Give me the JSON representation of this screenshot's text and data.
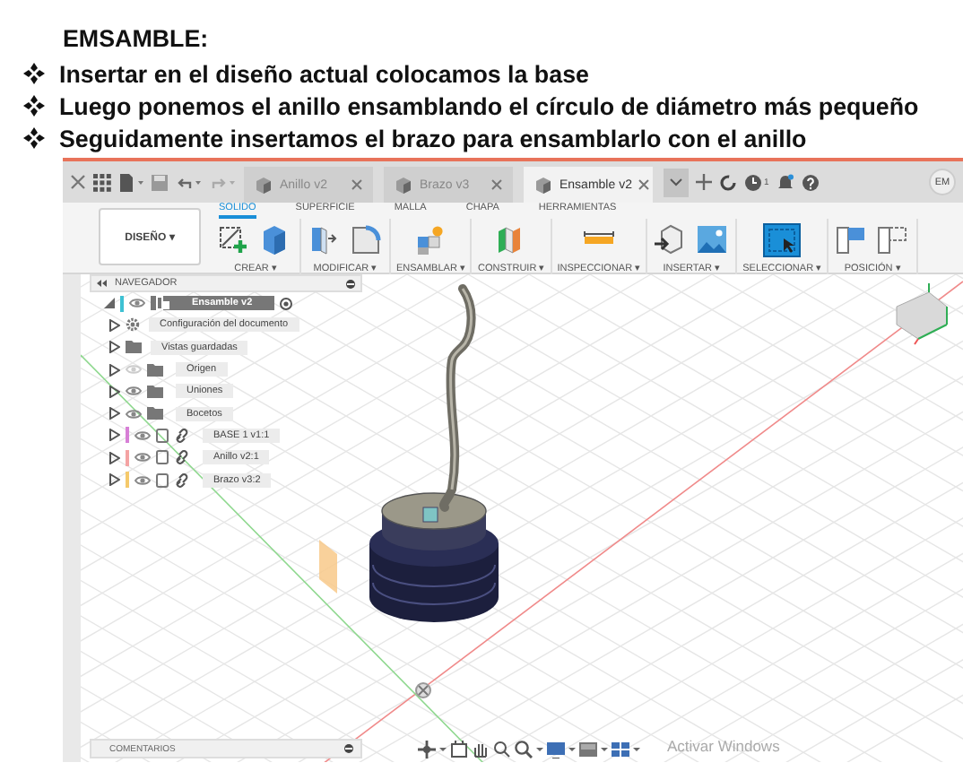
{
  "document": {
    "heading": "EMSAMBLE:",
    "bullets": [
      "Insertar en el diseño actual colocamos la base",
      "Luego ponemos el anillo ensamblando el círculo de diámetro más pequeño",
      "Seguidamente insertamos el brazo para ensamblarlo con el anillo"
    ]
  },
  "app": {
    "topbar": {
      "tabs": [
        {
          "label": "Anillo v2",
          "selected": false
        },
        {
          "label": "Brazo v3",
          "selected": false
        },
        {
          "label": "Ensamble v2",
          "selected": true
        }
      ],
      "job_count": "1",
      "avatar": "EM"
    },
    "ribbon": {
      "workspace": "DISEÑO ▾",
      "tabs": [
        {
          "label": "SOLIDO",
          "selected": true
        },
        {
          "label": "SUPERFICIE",
          "selected": false
        },
        {
          "label": "MALLA",
          "selected": false
        },
        {
          "label": "CHAPA",
          "selected": false
        },
        {
          "label": "HERRAMIENTAS",
          "selected": false
        }
      ],
      "groups": [
        "CREAR ▾",
        "MODIFICAR ▾",
        "ENSAMBLAR ▾",
        "CONSTRUIR ▾",
        "INSPECCIONAR ▾",
        "INSERTAR ▾",
        "SELECCIONAR ▾",
        "POSICIÓN ▾"
      ]
    },
    "navigator": {
      "title": "NAVEGADOR",
      "root": {
        "label": "Ensamble v2",
        "expanded": true,
        "selected": true,
        "children": [
          {
            "kind": "settings",
            "label": "Configuración del documento",
            "expanded": false,
            "selected": false
          },
          {
            "kind": "views",
            "label": "Vistas guardadas",
            "expanded": false,
            "selected": false
          },
          {
            "kind": "folder",
            "label": "Origen",
            "visible": false,
            "expanded": false,
            "selected": false
          },
          {
            "kind": "folder",
            "label": "Uniones",
            "visible": true,
            "expanded": false,
            "selected": false
          },
          {
            "kind": "folder",
            "label": "Bocetos",
            "visible": true,
            "expanded": false,
            "selected": false
          },
          {
            "kind": "component",
            "label": "BASE 1 v1:1",
            "color": "#d77fd6",
            "visible": true,
            "expanded": false,
            "selected": false
          },
          {
            "kind": "component",
            "label": "Anillo v2:1",
            "color": "#f4a3a3",
            "visible": true,
            "expanded": false,
            "selected": false
          },
          {
            "kind": "component",
            "label": "Brazo v3:2",
            "color": "#f5c96b",
            "visible": true,
            "expanded": false,
            "selected": false
          }
        ]
      }
    },
    "comments": {
      "title": "COMENTARIOS"
    },
    "os_notice": "Activar Windows"
  }
}
